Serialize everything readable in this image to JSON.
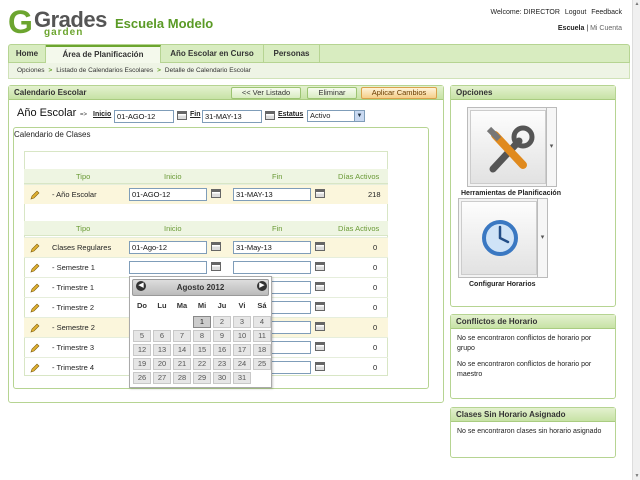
{
  "header": {
    "logo_text_main": "Grades",
    "logo_text_sub": "garden",
    "school_name": "Escuela Modelo",
    "welcome": "Welcome: DIRECTOR",
    "logout": "Logout",
    "feedback": "Feedback",
    "view_current": "Escuela",
    "view_separator": "|",
    "view_alt": "Mi Cuenta"
  },
  "nav": {
    "tabs": [
      "Home",
      "Área de Planificación",
      "Año Escolar en Curso",
      "Personas"
    ]
  },
  "breadcrumb": [
    "Opciones",
    "Listado de Calendarios Escolares",
    "Detalle de Calendario Escolar"
  ],
  "calendar_panel": {
    "title": "Calendario Escolar",
    "back_button": "<< Ver Listado",
    "delete_button": "Eliminar",
    "apply_button": "Aplicar Cambios",
    "year_title": "Año Escolar",
    "arrow": "=>",
    "start_label": "Inicio",
    "start_value": "01-AGO-12",
    "end_label": "Fin",
    "end_value": "31-MAY-13",
    "status_label": "Estatus",
    "status_value": "Activo"
  },
  "classes_panel": {
    "title": "Calendario de Clases",
    "columns": [
      "Tipo",
      "Inicio",
      "Fin",
      "Días Activos"
    ],
    "school_year_row": {
      "tipo": "- Año Escolar",
      "inicio": "01-AGO-12",
      "fin": "31-MAY-13",
      "dias": "218"
    },
    "rows": [
      {
        "tipo": "Clases Regulares",
        "inicio": "01-Ago-12",
        "fin": "31-May-13",
        "dias": "0"
      },
      {
        "tipo": "- Semestre 1",
        "inicio": "",
        "fin": "",
        "dias": "0"
      },
      {
        "tipo": "- Trimestre 1",
        "inicio": "",
        "fin": "",
        "dias": "0"
      },
      {
        "tipo": "- Trimestre 2",
        "inicio": "",
        "fin": "",
        "dias": "0"
      },
      {
        "tipo": "- Semestre 2",
        "inicio": "",
        "fin": "",
        "dias": "0"
      },
      {
        "tipo": "- Trimestre 3",
        "inicio": "",
        "fin": "",
        "dias": "0"
      },
      {
        "tipo": "- Trimestre 4",
        "inicio": "",
        "fin": "",
        "dias": "0"
      }
    ]
  },
  "datepicker": {
    "month_label": "Agosto 2012",
    "prev": "◀",
    "next": "▶",
    "day_names": [
      "Do",
      "Lu",
      "Ma",
      "Mi",
      "Ju",
      "Vi",
      "Sá"
    ],
    "weeks": [
      [
        "",
        "",
        "",
        "1",
        "2",
        "3",
        "4"
      ],
      [
        "5",
        "6",
        "7",
        "8",
        "9",
        "10",
        "11"
      ],
      [
        "12",
        "13",
        "14",
        "15",
        "16",
        "17",
        "18"
      ],
      [
        "19",
        "20",
        "21",
        "22",
        "23",
        "24",
        "25"
      ],
      [
        "26",
        "27",
        "28",
        "29",
        "30",
        "31",
        ""
      ]
    ],
    "selected_day": "1"
  },
  "options_panel": {
    "title": "Opciones",
    "tool1_label": "Herramientas de Planificación",
    "tool2_label": "Configurar Horarios"
  },
  "conflicts_panel": {
    "title": "Conflictos de Horario",
    "msg1": "No se encontraron conflictos de horario por grupo",
    "msg2": "No se encontraron conflictos de horario por maestro"
  },
  "unassigned_panel": {
    "title": "Clases Sin Horario Asignado",
    "msg": "No se encontraron clases sin horario asignado"
  },
  "colors": {
    "accent_green": "#6ca52f",
    "panel_header": "#c7e2a5",
    "apply_orange": "#f5cf8a",
    "alt_row": "#fbf6dc"
  }
}
